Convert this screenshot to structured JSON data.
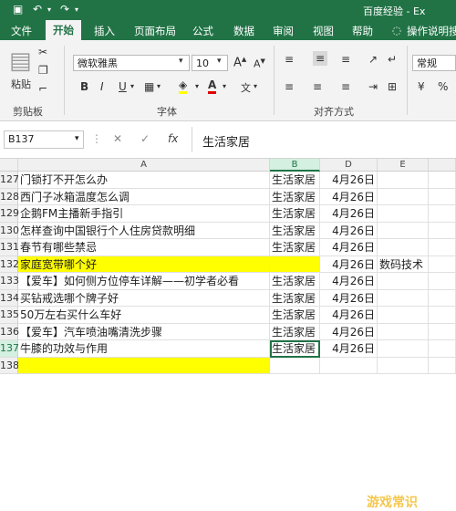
{
  "window": {
    "title": "百度经验 - Ex"
  },
  "quick_access": {
    "save_icon": "save-icon",
    "undo_icon": "undo-icon",
    "redo_icon": "redo-icon"
  },
  "tabs": [
    "文件",
    "开始",
    "插入",
    "页面布局",
    "公式",
    "数据",
    "审阅",
    "视图",
    "帮助"
  ],
  "tell_me": "操作说明搜",
  "ribbon": {
    "clipboard": {
      "label": "剪贴板",
      "paste_label": "粘贴"
    },
    "font": {
      "label": "字体",
      "name": "微软雅黑",
      "size": "10",
      "bold": "B",
      "italic": "I",
      "underline": "U",
      "font_color_letter": "A",
      "fill_icon": "fill-color-icon"
    },
    "alignment": {
      "label": "对齐方式"
    },
    "number": {
      "format": "常规"
    }
  },
  "formula_bar": {
    "name_box": "B137",
    "cancel": "✕",
    "confirm": "✓",
    "fx": "fx",
    "content": "生活家居"
  },
  "columns": [
    "A",
    "B",
    "D",
    "E"
  ],
  "rows": [
    {
      "num": "127",
      "a": "门锁打不开怎么办",
      "b": "生活家居",
      "c": "4月26日",
      "d": ""
    },
    {
      "num": "128",
      "a": "西门子冰箱温度怎么调",
      "b": "生活家居",
      "c": "4月26日",
      "d": ""
    },
    {
      "num": "129",
      "a": "企鹅FM主播新手指引",
      "b": "生活家居",
      "c": "4月26日",
      "d": ""
    },
    {
      "num": "130",
      "a": "怎样查询中国银行个人住房贷款明细",
      "b": "生活家居",
      "c": "4月26日",
      "d": ""
    },
    {
      "num": "131",
      "a": "春节有哪些禁忌",
      "b": "生活家居",
      "c": "4月26日",
      "d": ""
    },
    {
      "num": "132",
      "a": "家庭宽带哪个好",
      "b": "",
      "c": "4月26日",
      "d": "数码技术"
    },
    {
      "num": "133",
      "a": "【爱车】如何侧方位停车详解——初学者必看",
      "b": "生活家居",
      "c": "4月26日",
      "d": ""
    },
    {
      "num": "134",
      "a": "买钻戒选哪个牌子好",
      "b": "生活家居",
      "c": "4月26日",
      "d": ""
    },
    {
      "num": "135",
      "a": "50万左右买什么车好",
      "b": "生活家居",
      "c": "4月26日",
      "d": ""
    },
    {
      "num": "136",
      "a": "【爱车】汽车喷油嘴清洗步骤",
      "b": "生活家居",
      "c": "4月26日",
      "d": ""
    },
    {
      "num": "137",
      "a": "牛膝的功效与作用",
      "b": "生活家居",
      "c": "4月26日",
      "d": ""
    },
    {
      "num": "138",
      "a": "",
      "b": "",
      "c": "",
      "d": ""
    }
  ],
  "highlight_color": "#ffff00",
  "accent_color": "#217346",
  "watermark": "游戏常识"
}
